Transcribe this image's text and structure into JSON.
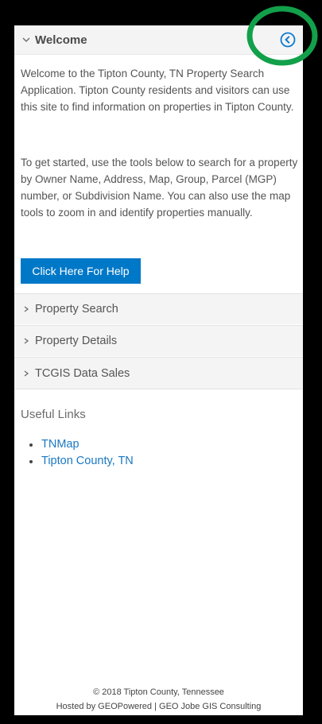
{
  "welcome": {
    "title": "Welcome",
    "intro_paragraph_1": "Welcome to the Tipton County, TN Property Search Application. Tipton County residents and visitors can use this site to find information on properties in Tipton County.",
    "intro_paragraph_2": "To get started, use the tools below to search for a property by Owner Name, Address, Map, Group, Parcel (MGP) number, or Subdivision Name. You can also use the map tools to zoom in and identify properties manually.",
    "help_button_label": "Click Here For Help"
  },
  "sections": [
    {
      "label": "Property Search"
    },
    {
      "label": "Property Details"
    },
    {
      "label": "TCGIS Data Sales"
    }
  ],
  "useful_links": {
    "title": "Useful Links",
    "items": [
      "TNMap",
      "Tipton County, TN"
    ]
  },
  "footer": {
    "copyright": "© 2018 Tipton County, Tennessee",
    "hosted_by": "Hosted by GEOPowered | GEO Jobe GIS Consulting"
  },
  "colors": {
    "accent": "#0078c8",
    "link": "#1a78c2",
    "highlight": "#12a04a"
  }
}
